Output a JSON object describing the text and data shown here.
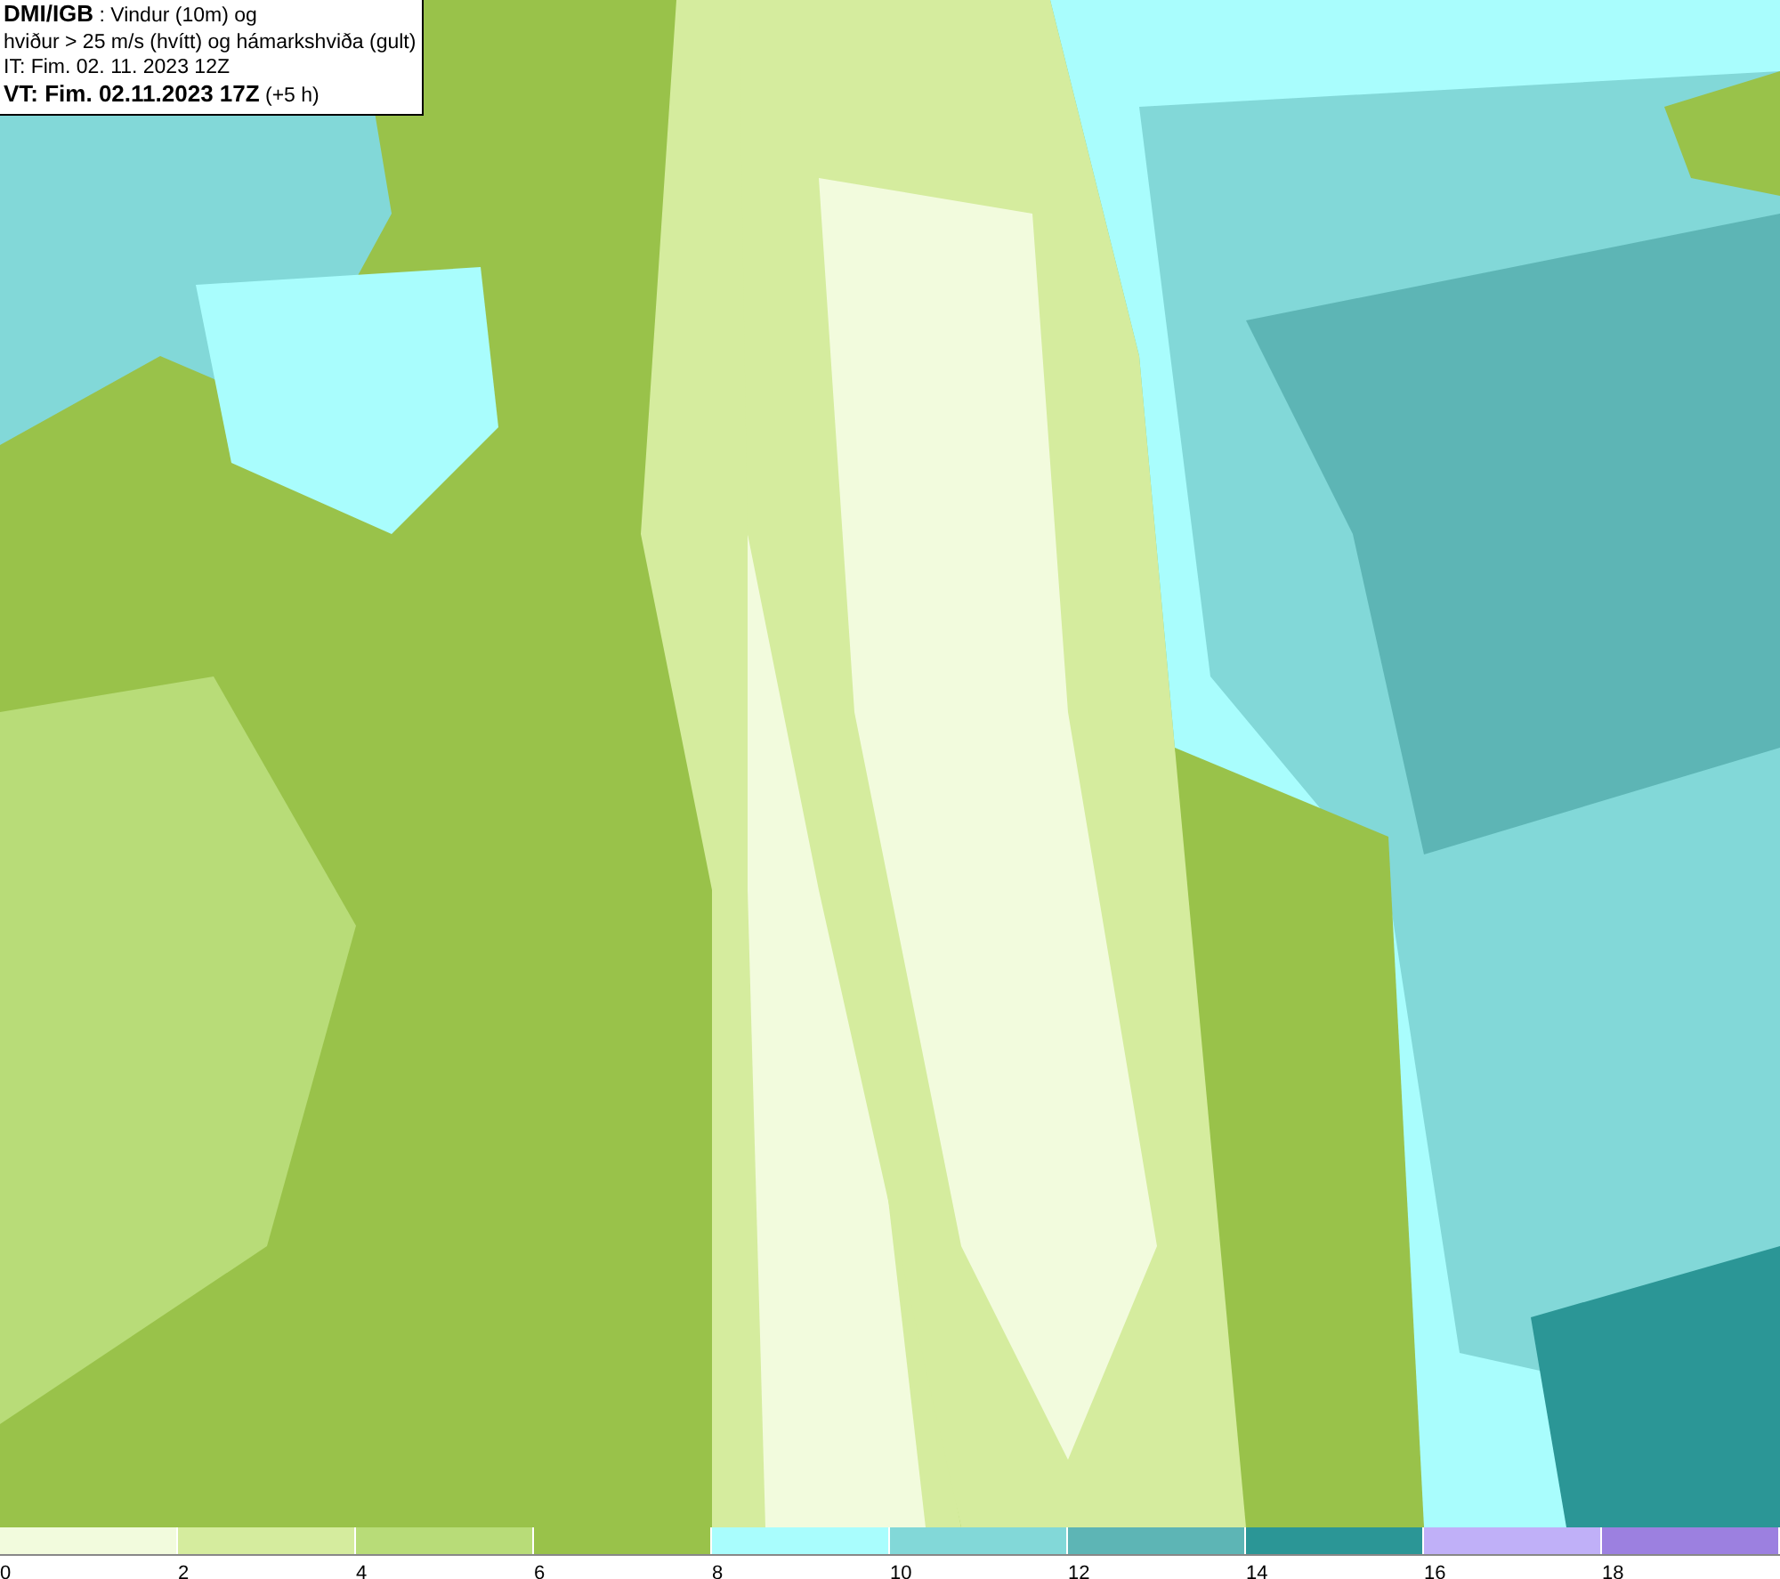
{
  "info_box": {
    "lines": [
      "**DMI/IGB** : Vindur (10m) og",
      "hviður > 25 m/s (hvítt) og hámarkshviða (gult)",
      "IT: Fim. 02. 11. 2023 12Z",
      "**VT: Fim. 02.11.2023 17Z** (+5 h)"
    ]
  },
  "legend": {
    "swatches": [
      {
        "color": "#f2fbdd"
      },
      {
        "color": "#d5ec9e"
      },
      {
        "color": "#b8dc78"
      },
      {
        "color": "#99c24a"
      },
      {
        "color": "#a9fdfd"
      },
      {
        "color": "#82d8d8"
      },
      {
        "color": "#5db5b5"
      },
      {
        "color": "#2b9696"
      },
      {
        "color": "#c0b0f8"
      },
      {
        "color": "#9c80e0"
      }
    ],
    "ticks": [
      "0",
      "2",
      "4",
      "6",
      "8",
      "10",
      "12",
      "14",
      "16",
      "18"
    ]
  }
}
